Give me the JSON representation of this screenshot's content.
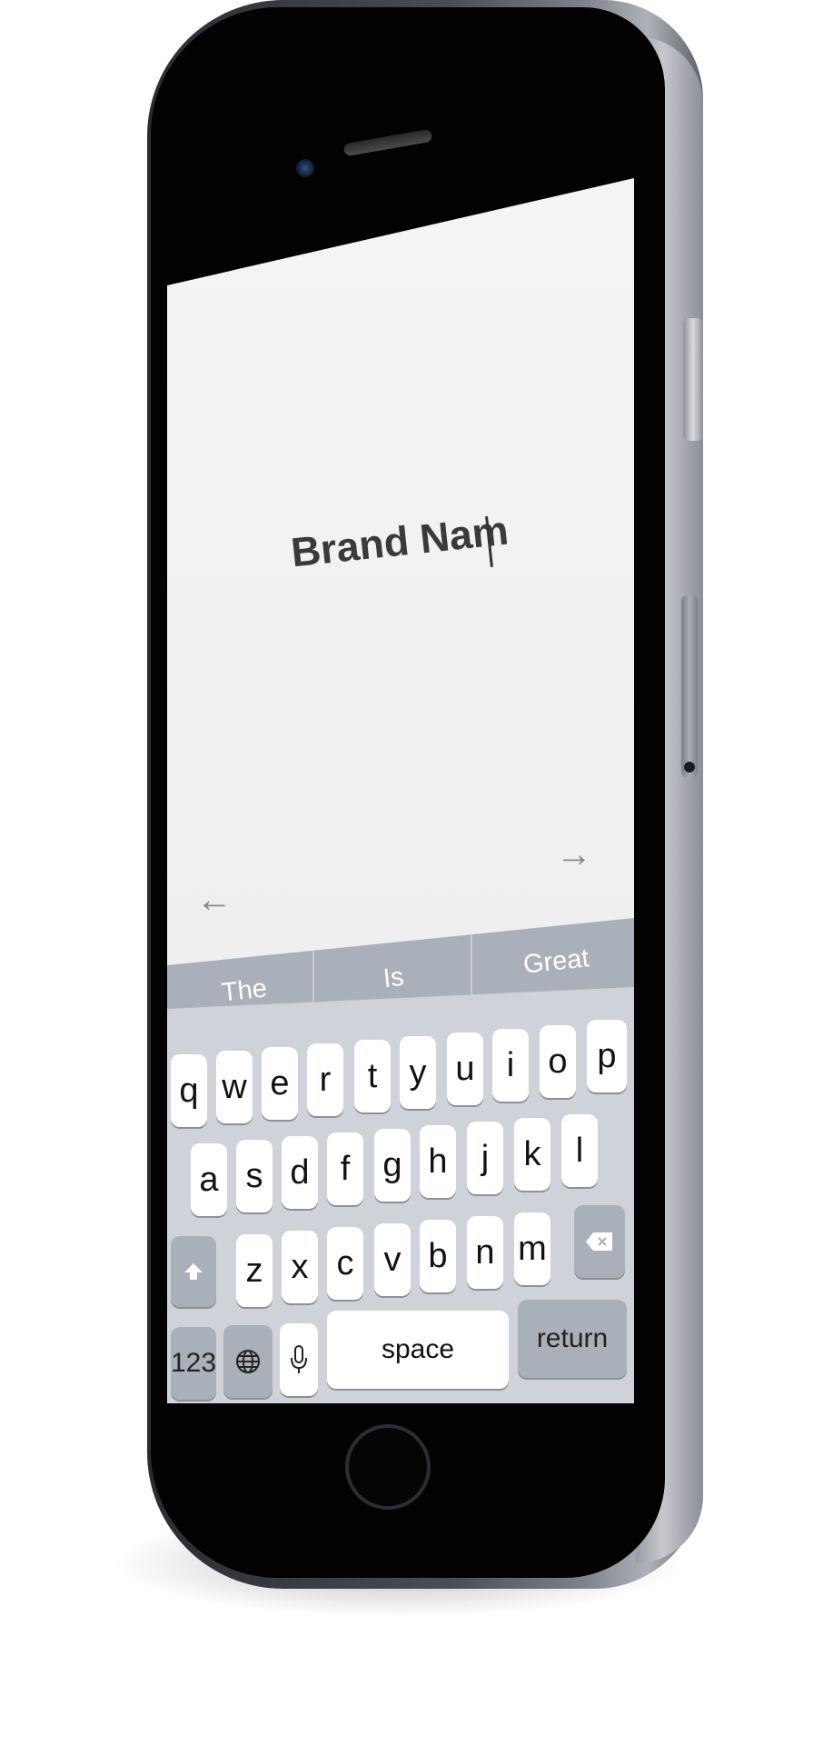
{
  "editor": {
    "text": "Brand Nam"
  },
  "navigation": {
    "prev_icon": "arrow-left-icon",
    "next_icon": "arrow-right-icon"
  },
  "predictive": {
    "suggestions": [
      "The",
      "Is",
      "Great"
    ]
  },
  "keyboard": {
    "row1": [
      "q",
      "w",
      "e",
      "r",
      "t",
      "y",
      "u",
      "i",
      "o",
      "p"
    ],
    "row2": [
      "a",
      "s",
      "d",
      "f",
      "g",
      "h",
      "j",
      "k",
      "l"
    ],
    "row3": [
      "z",
      "x",
      "c",
      "v",
      "b",
      "n",
      "m"
    ],
    "numbers_label": "123",
    "space_label": "space",
    "return_label": "return",
    "icons": [
      "shift-icon",
      "backspace-icon",
      "globe-icon",
      "microphone-icon"
    ]
  },
  "colors": {
    "screen_bg": "#eeeeee",
    "keyboard_bg": "#cfd3d9",
    "function_key": "#aab0b9",
    "text": "#3a3a3a"
  }
}
